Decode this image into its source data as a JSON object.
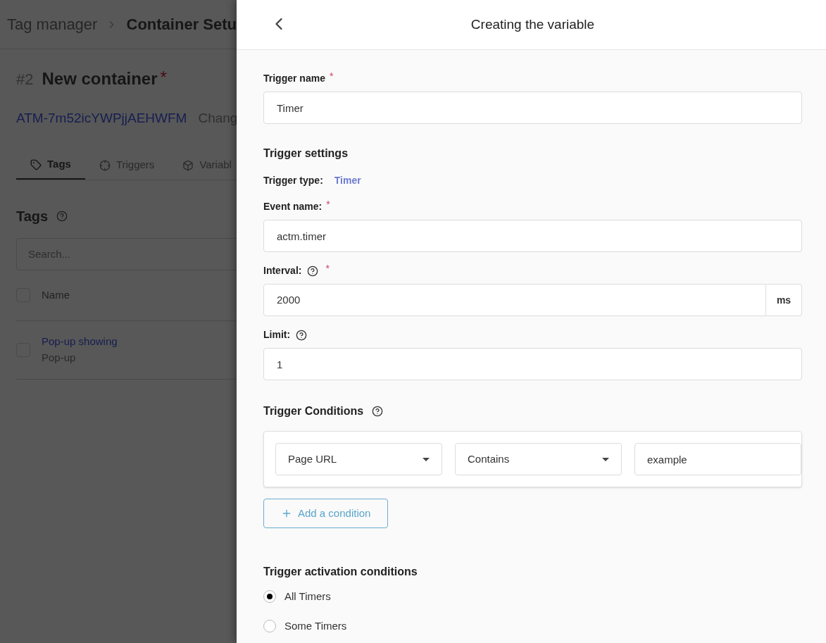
{
  "background": {
    "breadcrumb": [
      {
        "label": "Tag manager"
      },
      {
        "label": "Container Setu"
      }
    ],
    "container": {
      "number": "#2",
      "name": "New container",
      "required_mark": "*",
      "id": "ATM-7m52icYWPjjAEHWFM",
      "action": "Chang"
    },
    "tabs": [
      {
        "label": "Tags",
        "selected": true
      },
      {
        "label": "Triggers",
        "selected": false
      },
      {
        "label": "Variabl",
        "selected": false
      }
    ],
    "section_title": "Tags",
    "search": {
      "placeholder": "Search..."
    },
    "table": {
      "header": {
        "label": "Name",
        "checked": false
      },
      "rows": [
        {
          "name": "Pop-up showing",
          "type": "Pop-up",
          "checked": false
        }
      ]
    }
  },
  "panel": {
    "title": "Creating the variable",
    "trigger_name": {
      "label": "Trigger name",
      "required_mark": "*",
      "value": "Timer"
    },
    "settings_title": "Trigger settings",
    "trigger_type": {
      "label": "Trigger type:",
      "value": "Timer"
    },
    "event_name": {
      "label": "Event name:",
      "required_mark": "*",
      "value": "actm.timer"
    },
    "interval": {
      "label": "Interval:",
      "required_mark": "*",
      "value": "2000",
      "unit": "ms"
    },
    "limit": {
      "label": "Limit:",
      "value": "1"
    },
    "conditions_title": "Trigger Conditions",
    "conditions": [
      {
        "variable": "Page URL",
        "operator": "Contains",
        "value": "example"
      }
    ],
    "add_condition": "Add a condition",
    "activation_title": "Trigger activation conditions",
    "activation_options": [
      {
        "label": "All Timers",
        "selected": true
      },
      {
        "label": "Some Timers",
        "selected": false
      }
    ]
  }
}
